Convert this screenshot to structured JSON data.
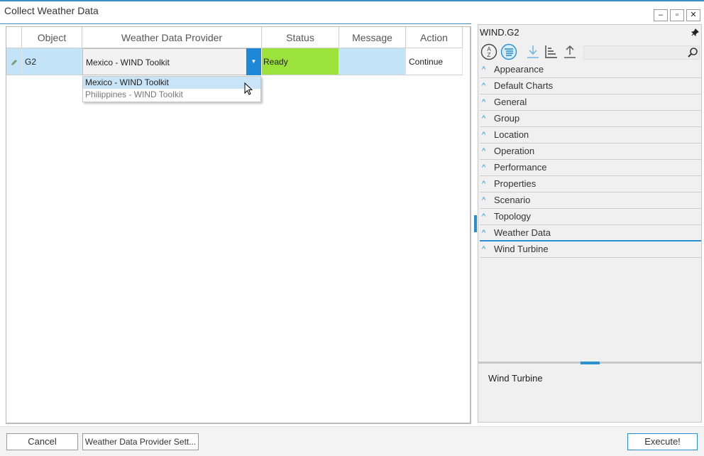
{
  "window": {
    "title": "Collect Weather Data",
    "minimize_label": "–",
    "maximize_label": "▫",
    "close_label": "✕"
  },
  "grid": {
    "columns": [
      "Object",
      "Weather Data Provider",
      "Status",
      "Message",
      "Action"
    ],
    "row": {
      "object": "G2",
      "provider": "Mexico - WIND Toolkit",
      "status": "Ready",
      "message": "",
      "action": "Continue"
    },
    "dropdown_options": [
      "Mexico - WIND Toolkit",
      "Philippines - WIND Toolkit"
    ],
    "dropdown_arrow": "▼"
  },
  "properties_panel": {
    "title": "WIND.G2",
    "icons": [
      "sort-alphabetical-icon",
      "sort-categorized-icon",
      "import-icon",
      "tree-icon",
      "export-icon",
      "search-icon",
      "pin-icon"
    ],
    "search_placeholder": "",
    "categories": [
      "Appearance",
      "Default Charts",
      "General",
      "Group",
      "Location",
      "Operation",
      "Performance",
      "Properties",
      "Scenario",
      "Topology",
      "Weather Data",
      "Wind Turbine"
    ],
    "chevron": "^",
    "description": "Wind Turbine"
  },
  "footer": {
    "cancel_label": "Cancel",
    "settings_label": "Weather Data Provider Sett...",
    "execute_label": "Execute!"
  },
  "colors": {
    "accent": "#1e88d8",
    "status_ready": "#9be33a",
    "row_highlight": "#c3e3f8"
  }
}
